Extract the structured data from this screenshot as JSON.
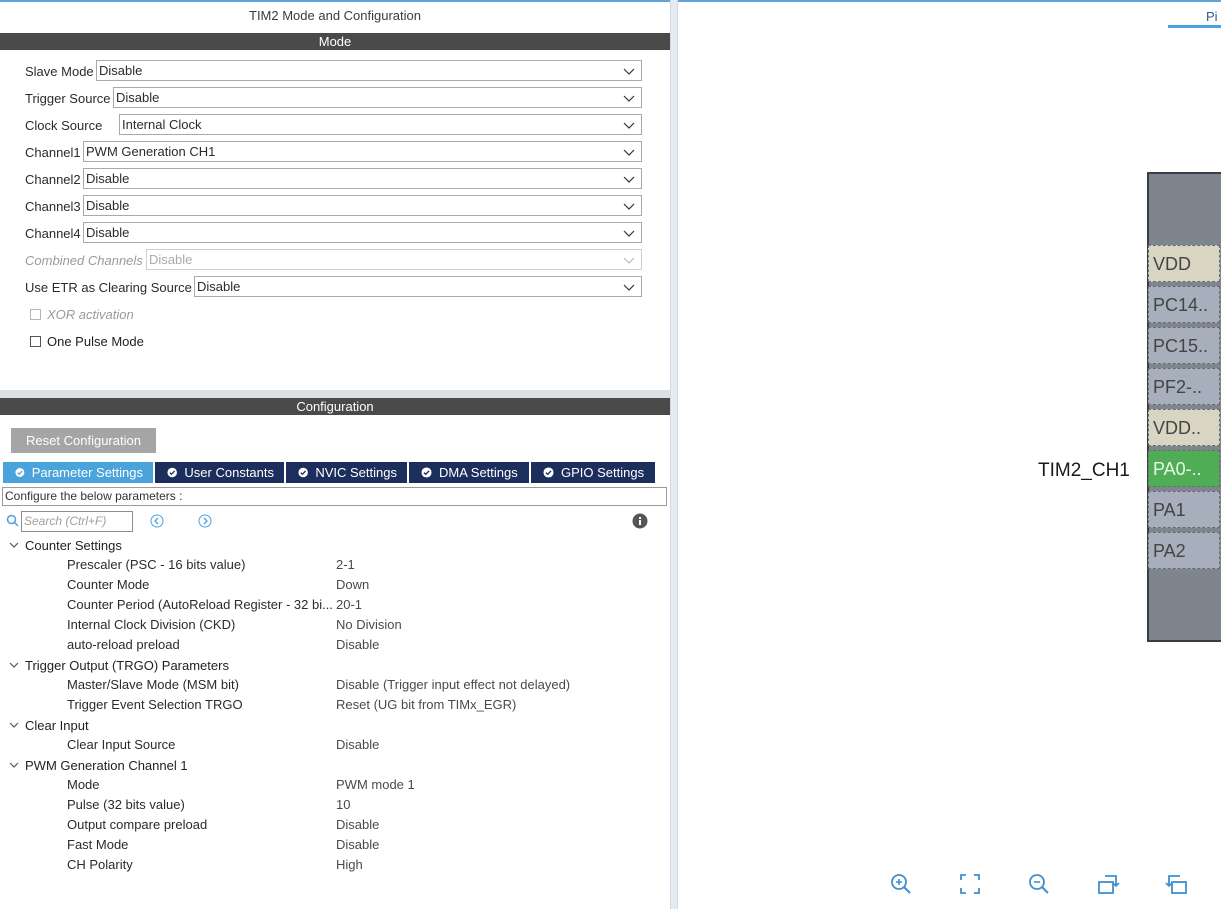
{
  "panel_title": "TIM2 Mode and Configuration",
  "mode_bar": "Mode",
  "mode": {
    "slave_mode": {
      "label": "Slave Mode",
      "value": "Disable"
    },
    "trigger_source": {
      "label": "Trigger Source",
      "value": "Disable"
    },
    "clock_source": {
      "label": "Clock Source",
      "value": "Internal Clock"
    },
    "channel1": {
      "label": "Channel1",
      "value": "PWM Generation CH1"
    },
    "channel2": {
      "label": "Channel2",
      "value": "Disable"
    },
    "channel3": {
      "label": "Channel3",
      "value": "Disable"
    },
    "channel4": {
      "label": "Channel4",
      "value": "Disable"
    },
    "combined_channels": {
      "label": "Combined Channels",
      "value": "Disable"
    },
    "use_etr": {
      "label": "Use ETR as Clearing Source",
      "value": "Disable"
    },
    "xor_activation": "XOR activation",
    "one_pulse_mode": "One Pulse Mode"
  },
  "config_bar": "Configuration",
  "reset_button": "Reset Configuration",
  "tabs": [
    {
      "label": "Parameter Settings"
    },
    {
      "label": "User Constants"
    },
    {
      "label": "NVIC Settings"
    },
    {
      "label": "DMA Settings"
    },
    {
      "label": "GPIO Settings"
    }
  ],
  "configure_text": "Configure the below parameters :",
  "search_placeholder": "Search (Ctrl+F)",
  "groups": {
    "counter": {
      "title": "Counter Settings",
      "params": [
        {
          "name": "Prescaler (PSC - 16 bits value)",
          "value": "2-1"
        },
        {
          "name": "Counter Mode",
          "value": "Down"
        },
        {
          "name": "Counter Period (AutoReload Register - 32 bi...",
          "value": "20-1"
        },
        {
          "name": "Internal Clock Division (CKD)",
          "value": "No Division"
        },
        {
          "name": "auto-reload preload",
          "value": "Disable"
        }
      ]
    },
    "trgo": {
      "title": "Trigger Output (TRGO) Parameters",
      "params": [
        {
          "name": "Master/Slave Mode (MSM bit)",
          "value": "Disable (Trigger input effect not delayed)"
        },
        {
          "name": "Trigger Event Selection TRGO",
          "value": "Reset (UG bit from TIMx_EGR)"
        }
      ]
    },
    "clear": {
      "title": "Clear Input",
      "params": [
        {
          "name": "Clear Input Source",
          "value": "Disable"
        }
      ]
    },
    "pwm": {
      "title": "PWM Generation Channel 1",
      "params": [
        {
          "name": "Mode",
          "value": "PWM mode 1"
        },
        {
          "name": "Pulse (32 bits value)",
          "value": "10"
        },
        {
          "name": "Output compare preload",
          "value": "Disable"
        },
        {
          "name": "Fast Mode",
          "value": "Disable"
        },
        {
          "name": "CH Polarity",
          "value": "High"
        }
      ]
    }
  },
  "pinout": {
    "tab_label": "Pi",
    "pins": [
      "VDD",
      "PC14..",
      "PC15..",
      "PF2-..",
      "VDD..",
      "PA0-..",
      "PA1",
      "PA2"
    ],
    "signal_label": "TIM2_CH1"
  },
  "colors": {
    "accent": "#4ba3dc",
    "tab_dark": "#1c2f5c",
    "section_bar": "#4a4a4a",
    "pin_active": "#4fae55"
  }
}
